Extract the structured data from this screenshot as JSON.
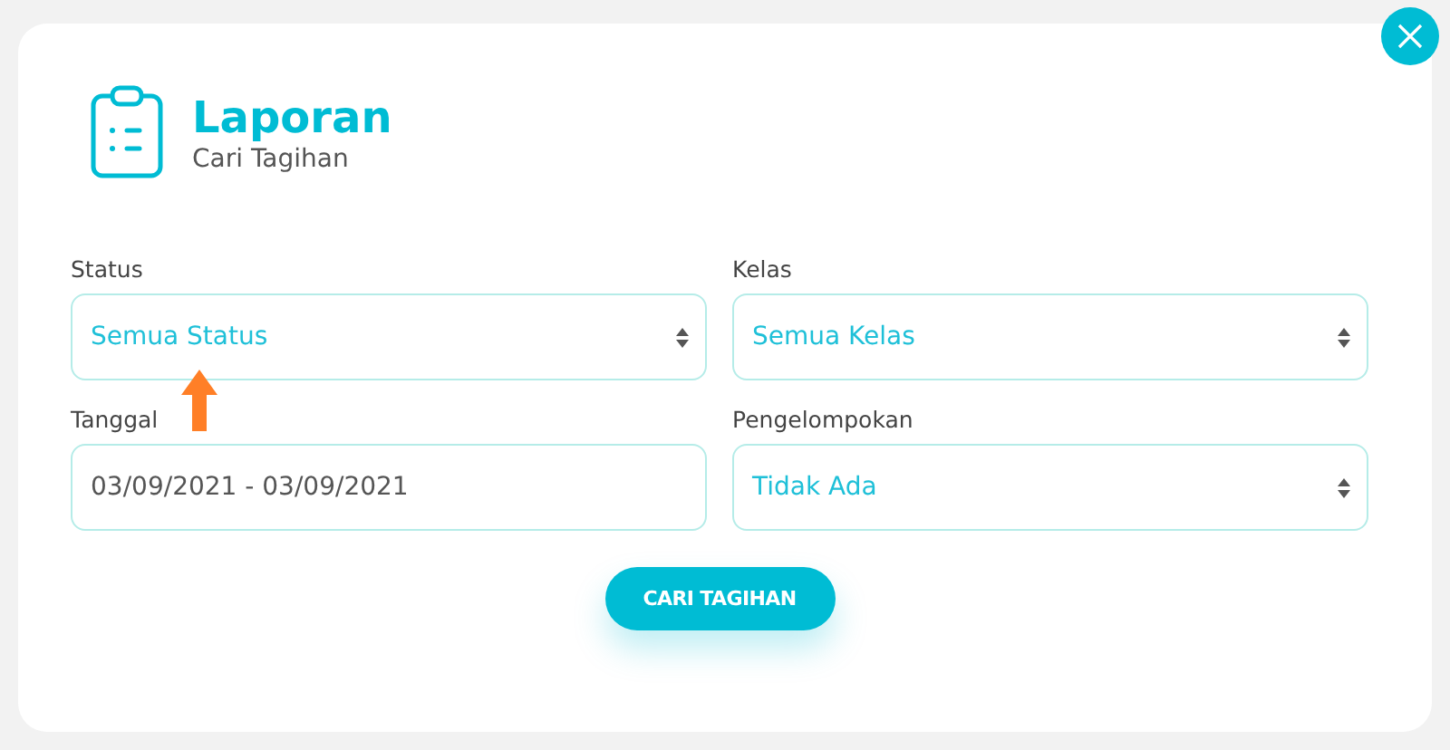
{
  "dialog": {
    "title": "Laporan",
    "subtitle": "Cari Tagihan"
  },
  "fields": [
    {
      "label": "Status",
      "kind": "select",
      "value": "Semua Status"
    },
    {
      "label": "Kelas",
      "kind": "select",
      "value": "Semua Kelas"
    },
    {
      "label": "Tanggal",
      "kind": "date",
      "value": "03/09/2021 - 03/09/2021"
    },
    {
      "label": "Pengelompokan",
      "kind": "select",
      "value": "Tidak Ada"
    }
  ],
  "submit_button": "CARI TAGIHAN"
}
